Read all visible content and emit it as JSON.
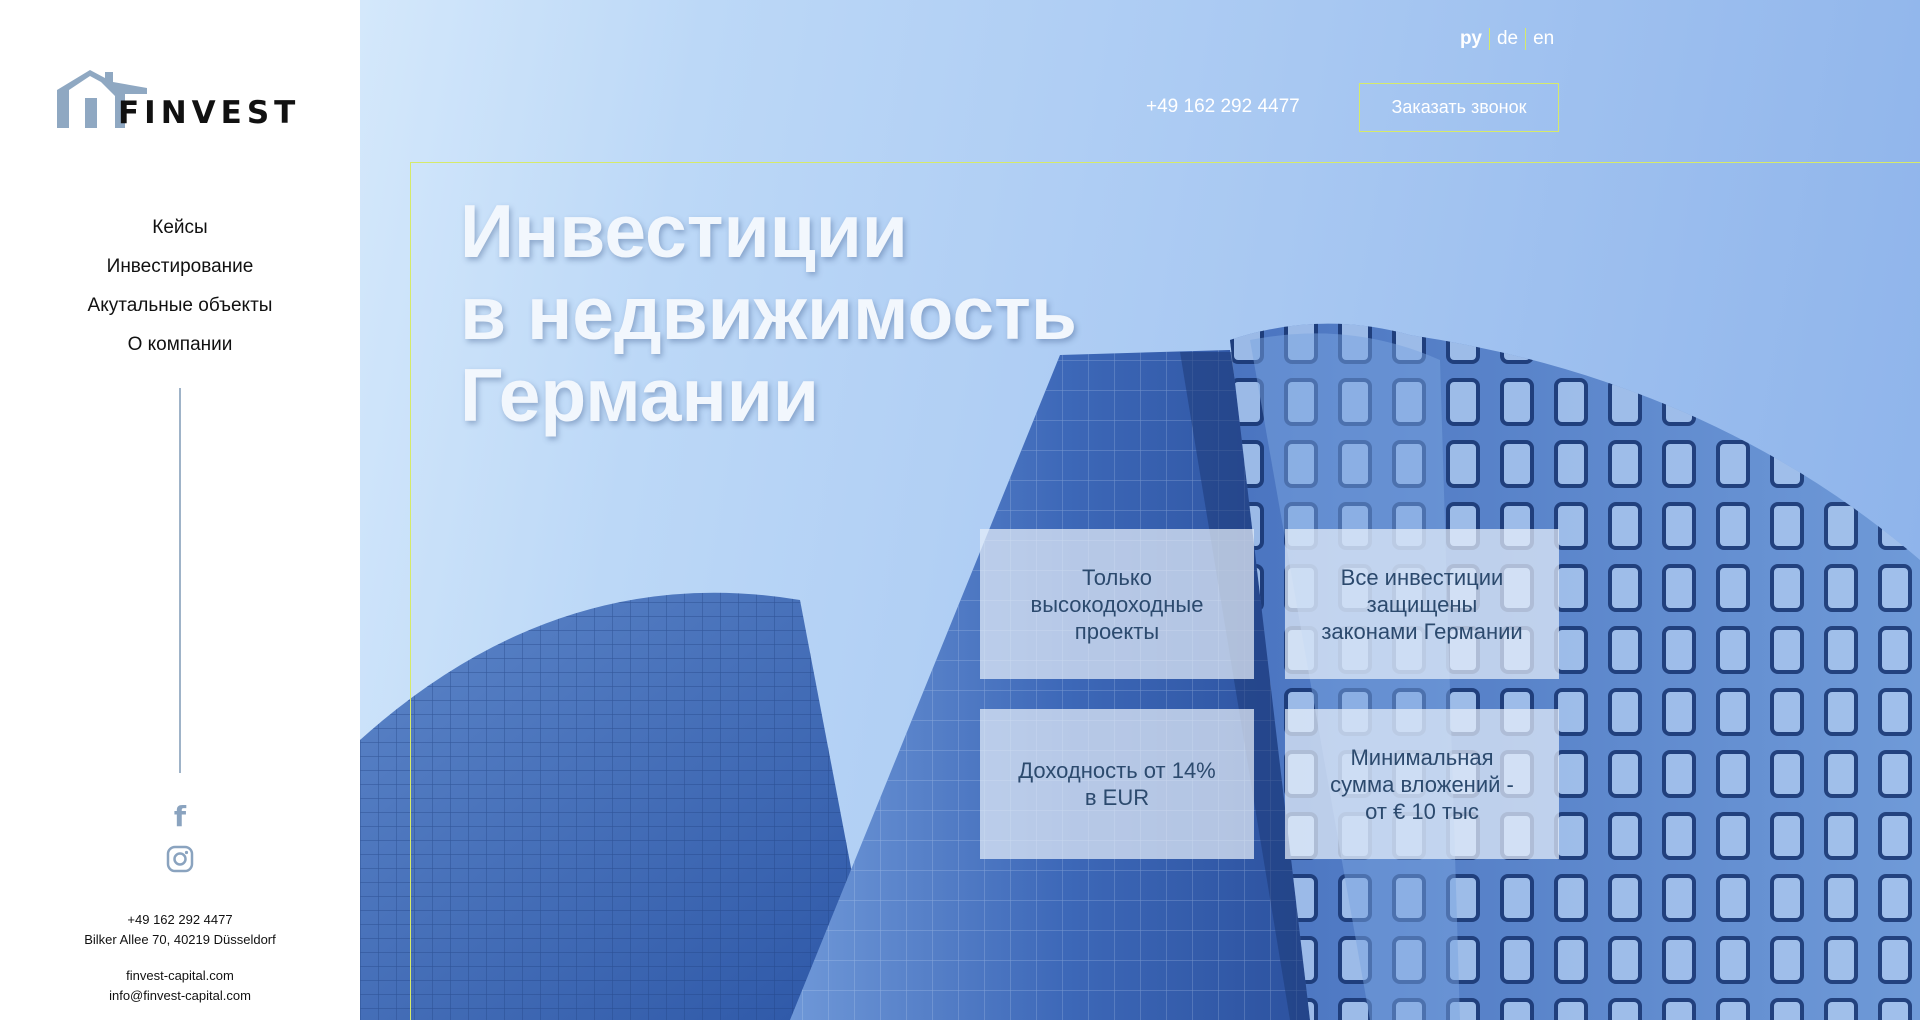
{
  "brand": {
    "name": "FINVEST",
    "color": "#8fa8c2"
  },
  "nav": {
    "items": [
      {
        "label": "Кейсы"
      },
      {
        "label": "Инвестирование"
      },
      {
        "label": "Акутальные объекты"
      },
      {
        "label": "О компании"
      }
    ]
  },
  "social": {
    "facebook_icon": "facebook-icon",
    "instagram_icon": "instagram-icon",
    "color": "#8aa3bf"
  },
  "contacts": {
    "phone": "+49 162 292 4477",
    "address": "Bilker Allee 70, 40219 Düsseldorf",
    "website": "finvest-capital.com",
    "email": "info@finvest-capital.com"
  },
  "header": {
    "languages": [
      {
        "label": "ру",
        "active": true
      },
      {
        "label": "de",
        "active": false
      },
      {
        "label": "en",
        "active": false
      }
    ],
    "phone": "+49 162 292 4477",
    "callback_label": "Заказать звонок",
    "accent": "#d6ea6a"
  },
  "hero": {
    "title_lines": [
      "Инвестиции",
      "в недвижимость",
      "Германии"
    ]
  },
  "features": [
    {
      "text": "Только\nвысокодоходные\nпроекты"
    },
    {
      "text": "Все инвестиции\nзащищены\nзаконами Германии"
    },
    {
      "text": "Доходность от 14%\nв EUR"
    },
    {
      "text": "Минимальная\nсумма вложений -\nот € 10 тыс"
    }
  ]
}
